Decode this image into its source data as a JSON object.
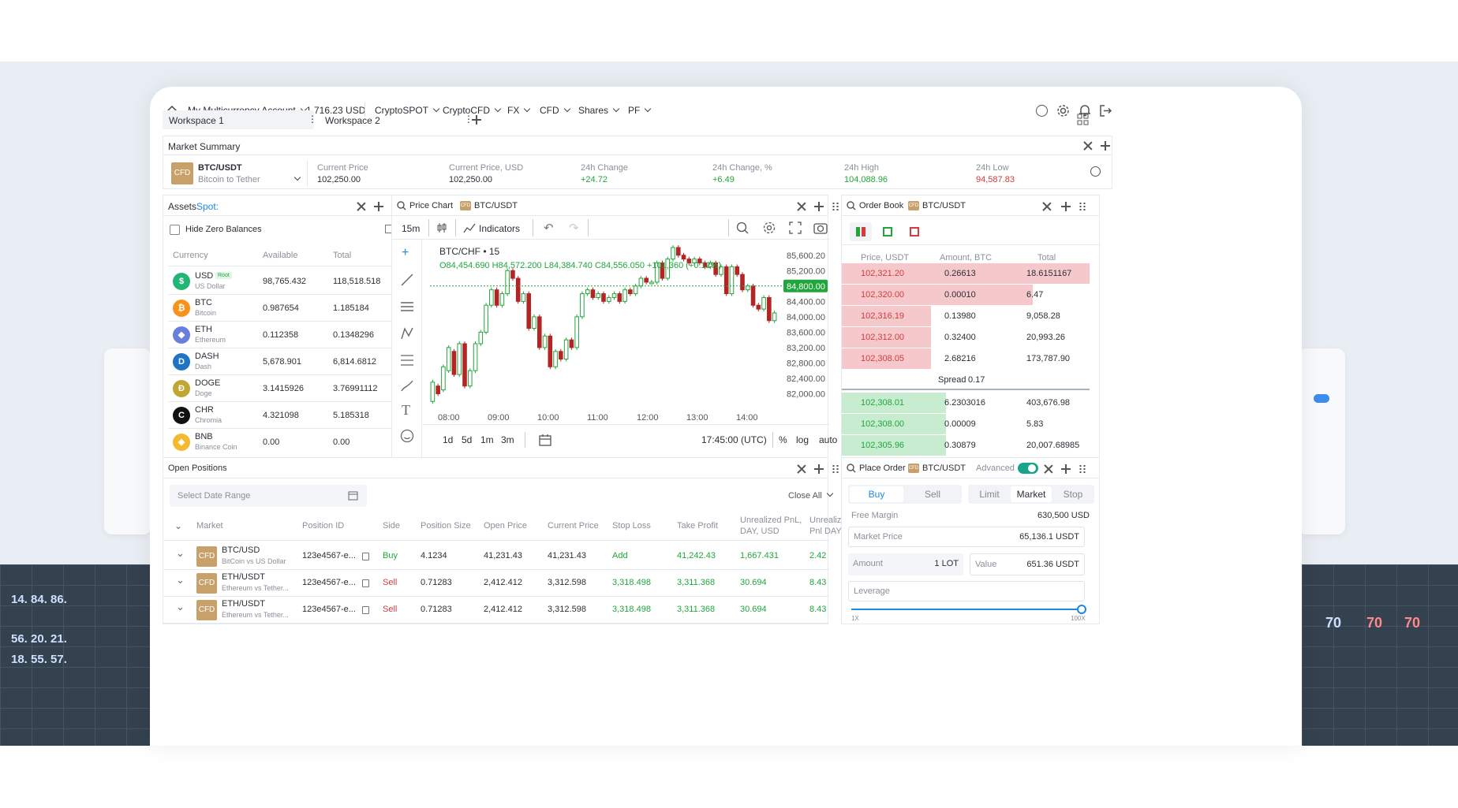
{
  "nav": {
    "account": "My Multicurrency Account",
    "balance": "1,716.23 USD",
    "menus": [
      "CryptoSPOT",
      "CryptoCFD",
      "FX",
      "CFD",
      "Shares",
      "PF"
    ]
  },
  "workspaces": [
    "Workspace 1",
    "Workspace 2"
  ],
  "market_summary": {
    "title": "Market Summary",
    "badge": "CFD",
    "symbol": "BTC/USDT",
    "name": "Bitcoin to Tether",
    "stats": [
      {
        "label": "Current Price",
        "value": "102,250.00",
        "color": "#2b2f36"
      },
      {
        "label": "Current Price, USD",
        "value": "102,250.00",
        "color": "#2b2f36"
      },
      {
        "label": "24h Change",
        "value": "+24.72",
        "color": "#21a63b"
      },
      {
        "label": "24h Change, %",
        "value": "+6.49",
        "color": "#21a63b"
      },
      {
        "label": "24h High",
        "value": "104,088.96",
        "color": "#21a63b"
      },
      {
        "label": "24h Low",
        "value": "94,587.83",
        "color": "#d43b3b"
      }
    ]
  },
  "assets": {
    "title": "Assets",
    "spot": "Spot:",
    "hide_zero": "Hide Zero Balances",
    "headers": [
      "Currency",
      "Available",
      "Total"
    ],
    "rows": [
      {
        "code": "USD",
        "name": "US Dollar",
        "tag": "Root",
        "available": "98,765.432",
        "total": "118,518.518",
        "color": "#22b573",
        "glyph": "$"
      },
      {
        "code": "BTC",
        "name": "Bitcoin",
        "tag": "",
        "available": "0.987654",
        "total": "1.185184",
        "color": "#f7931a",
        "glyph": "₿"
      },
      {
        "code": "ETH",
        "name": "Ethereum",
        "tag": "",
        "available": "0.112358",
        "total": "0.1348296",
        "color": "#6a7fdb",
        "glyph": "◆"
      },
      {
        "code": "DASH",
        "name": "Dash",
        "tag": "",
        "available": "5,678.901",
        "total": "6,814.6812",
        "color": "#1f74c4",
        "glyph": "D"
      },
      {
        "code": "DOGE",
        "name": "Doge",
        "tag": "",
        "available": "3.1415926",
        "total": "3.76991112",
        "color": "#c2a633",
        "glyph": "Ð"
      },
      {
        "code": "CHR",
        "name": "Chromia",
        "tag": "",
        "available": "4.321098",
        "total": "5.185318",
        "color": "#111111",
        "glyph": "C"
      },
      {
        "code": "BNB",
        "name": "Binance Coin",
        "tag": "",
        "available": "0.00",
        "total": "0.00",
        "color": "#f3ba2f",
        "glyph": "◈"
      }
    ]
  },
  "price_chart": {
    "title": "Price Chart",
    "badge": "CFD",
    "symbol": "BTC/USDT",
    "interval": "15m",
    "indicators": "Indicators",
    "legend_title": "BTC/CHF • 15",
    "legend_ohlc": "O84,454.690 H84,572.200 L84,384.740 C84,556.050 +101,360 (+0.12%)",
    "price_tag": "84,800.00",
    "periods": [
      "1d",
      "5d",
      "1m",
      "3m"
    ],
    "time": "17:45:00 (UTC)",
    "opts": [
      "%",
      "log",
      "auto"
    ]
  },
  "chart_data": {
    "type": "candlestick",
    "title": "BTC/CHF • 15",
    "x": [
      "08:00",
      "09:00",
      "10:00",
      "11:00",
      "12:00",
      "13:00",
      "14:00"
    ],
    "ylim": [
      81600,
      85800
    ],
    "y_ticks": [
      "85,600.20",
      "85,200.00",
      "84,800.00",
      "84,400.00",
      "84,000.00",
      "83,600.00",
      "83,200.00",
      "82,800.00",
      "82,400.00",
      "82,000.00"
    ],
    "last_price": 84800,
    "candles": [
      [
        81800,
        82300
      ],
      [
        82200,
        82000
      ],
      [
        82100,
        82700
      ],
      [
        82600,
        83200
      ],
      [
        83100,
        82500
      ],
      [
        82500,
        83300
      ],
      [
        83300,
        82200
      ],
      [
        82200,
        82600
      ],
      [
        82600,
        83300
      ],
      [
        83300,
        83600
      ],
      [
        83600,
        84300
      ],
      [
        84300,
        84700
      ],
      [
        84700,
        84300
      ],
      [
        84300,
        84600
      ],
      [
        84600,
        85200
      ],
      [
        85200,
        85000
      ],
      [
        85000,
        84400
      ],
      [
        84400,
        84600
      ],
      [
        84600,
        83700
      ],
      [
        83700,
        84000
      ],
      [
        84000,
        83200
      ],
      [
        83200,
        83500
      ],
      [
        83500,
        82700
      ],
      [
        82700,
        83100
      ],
      [
        83100,
        82900
      ],
      [
        82900,
        83400
      ],
      [
        83400,
        83200
      ],
      [
        83200,
        84000
      ],
      [
        84000,
        84600
      ],
      [
        84600,
        84700
      ],
      [
        84700,
        84500
      ],
      [
        84500,
        84600
      ],
      [
        84600,
        84400
      ],
      [
        84400,
        84500
      ],
      [
        84500,
        84600
      ],
      [
        84600,
        84400
      ],
      [
        84400,
        84700
      ],
      [
        84700,
        84600
      ],
      [
        84600,
        84800
      ],
      [
        84800,
        85000
      ],
      [
        85000,
        84900
      ],
      [
        84900,
        84900
      ],
      [
        84900,
        85400
      ],
      [
        85400,
        85000
      ],
      [
        85000,
        85500
      ],
      [
        85500,
        85800
      ],
      [
        85800,
        85600
      ],
      [
        85600,
        85500
      ],
      [
        85500,
        85400
      ],
      [
        85400,
        85500
      ],
      [
        85500,
        85400
      ],
      [
        85400,
        85300
      ],
      [
        85300,
        85400
      ],
      [
        85400,
        85100
      ],
      [
        85100,
        85300
      ],
      [
        85300,
        84600
      ],
      [
        84600,
        85300
      ],
      [
        85300,
        85100
      ],
      [
        85100,
        84700
      ],
      [
        84700,
        84800
      ],
      [
        84800,
        84300
      ],
      [
        84300,
        84200
      ],
      [
        84200,
        84500
      ],
      [
        84500,
        83900
      ],
      [
        83900,
        84100
      ]
    ]
  },
  "order_book": {
    "title": "Order Book",
    "badge": "CFD",
    "symbol": "BTC/USDT",
    "headers": [
      "Price, USDT",
      "Amount, BTC",
      "Total"
    ],
    "asks": [
      [
        "102,321.20",
        "0.26613",
        "18.6151167",
        1.0
      ],
      [
        "102,320.00",
        "0.00010",
        "6.47",
        0.77
      ],
      [
        "102,316.19",
        "0.13980",
        "9,058.28",
        0.36
      ],
      [
        "102,312.00",
        "0.32400",
        "20,993.26",
        0.36
      ],
      [
        "102,308.05",
        "2.68216",
        "173,787.90",
        0.36
      ]
    ],
    "spread_label": "Spread",
    "spread": "0.17",
    "bids": [
      [
        "102,308.01",
        "6.2303016",
        "403,676.98",
        0.42
      ],
      [
        "102,308.00",
        "0.00009",
        "5.83",
        0.42
      ],
      [
        "102,305.96",
        "0.30879",
        "20,007.68985",
        0.42
      ]
    ]
  },
  "open_positions": {
    "title": "Open Positions",
    "date_placeholder": "Select Date Range",
    "close_all": "Close All",
    "headers": [
      "Market",
      "Position ID",
      "Side",
      "Position Size",
      "Open Price",
      "Current Price",
      "Stop Loss",
      "Take Profit",
      "Unrealized PnL, DAY, USD",
      "Unrealized Pnl DAY, %"
    ],
    "rows": [
      {
        "badge": "CFD",
        "symbol": "BTC/USD",
        "name": "BitCoin vs US Dollar",
        "id": "123e4567-e...",
        "side": "Buy",
        "size": "4.1234",
        "open": "41,231.43",
        "current": "41,231.43",
        "sl": "Add",
        "tp": "41,242.43",
        "pnl": "1,667.431",
        "pct": "2.42"
      },
      {
        "badge": "CFD",
        "symbol": "ETH/USDT",
        "name": "Ethereum vs Tether...",
        "id": "123e4567-e...",
        "side": "Sell",
        "size": "0.71283",
        "open": "2,412.412",
        "current": "3,312.598",
        "sl": "3,318.498",
        "tp": "3,311.368",
        "pnl": "30.694",
        "pct": "8.43"
      },
      {
        "badge": "CFD",
        "symbol": "ETH/USDT",
        "name": "Ethereum vs Tether...",
        "id": "123e4567-e...",
        "side": "Sell",
        "size": "0.71283",
        "open": "2,412.412",
        "current": "3,312.598",
        "sl": "3,318.498",
        "tp": "3,311.368",
        "pnl": "30.694",
        "pct": "8.43"
      }
    ]
  },
  "place_order": {
    "title": "Place Order",
    "badge": "CFD",
    "symbol": "BTC/USDT",
    "advanced": "Advanced",
    "tabs": [
      "Buy",
      "Sell"
    ],
    "types": [
      "Limit",
      "Market",
      "Stop"
    ],
    "free_margin_label": "Free Margin",
    "free_margin": "630,500 USD",
    "market_price_label": "Market Price",
    "market_price": "65,136.1 USDT",
    "amount_label": "Amount",
    "amount": "1 LOT",
    "value_label": "Value",
    "value": "651.36 USDT",
    "leverage_label": "Leverage",
    "lev_min": "1X",
    "lev_max": "100X",
    "leverage_level": 1.0
  },
  "colors": {
    "green": "#21a63b",
    "red": "#d43b3b",
    "accent": "#1e88e5",
    "ask_bg": "#f5c9cc",
    "bid_bg": "#c7ecd0",
    "cfd": "#c8a06a"
  }
}
